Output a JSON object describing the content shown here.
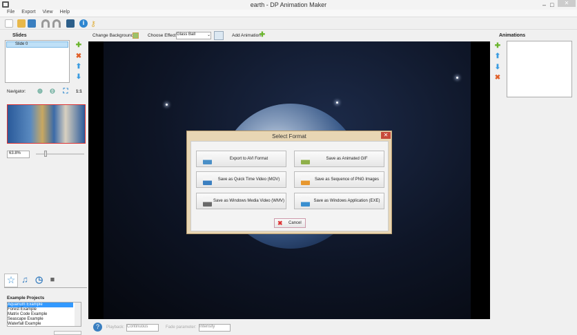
{
  "window": {
    "title": "earth - DP Animation Maker",
    "min": "–",
    "max": "□",
    "close": "✕"
  },
  "menu": [
    "File",
    "Export",
    "View",
    "Help"
  ],
  "toolbar2": {
    "change_background": "Change Background",
    "choose_effect_label": "Choose Effect:",
    "effect_value": "Glass Ball",
    "add_animation": "Add Animation"
  },
  "slides": {
    "title": "Slides",
    "items": [
      "Slide 0"
    ]
  },
  "navigator": {
    "label": "Navigator:",
    "one_to_one": "1:1",
    "zoom_value": "63.8%"
  },
  "animations": {
    "title": "Animations"
  },
  "examples": {
    "title": "Example Projects",
    "items": [
      "Aquarium Example",
      "Forest Example",
      "Matrix Code Example",
      "Seascape Example",
      "Waterfall Example"
    ],
    "selected": 0
  },
  "bottom": {
    "playback_label": "Playback:",
    "playback_value": "Continuous",
    "fade_label": "Fade parameter:",
    "fade_value": "Intensity"
  },
  "dialog": {
    "title": "Select Format",
    "close": "✕",
    "buttons": [
      {
        "label": "Export to AVI Format",
        "badge": "AVI",
        "color": "#4a8fc7"
      },
      {
        "label": "Save as Animated GIF",
        "badge": "GIF",
        "color": "#8fb04a"
      },
      {
        "label": "Save as Quick Time Video (MOV)",
        "badge": "MOV",
        "color": "#3a7fc0"
      },
      {
        "label": "Save as Sequence of PNG Images",
        "badge": "PNG",
        "color": "#e7972e"
      },
      {
        "label": "Save as Windows Media Video (WMV)",
        "badge": "WMV",
        "color": "#6a6a6a"
      },
      {
        "label": "Save as Windows Application (EXE)",
        "badge": "EXE",
        "color": "#3a8fd0"
      }
    ],
    "cancel": "Cancel"
  }
}
